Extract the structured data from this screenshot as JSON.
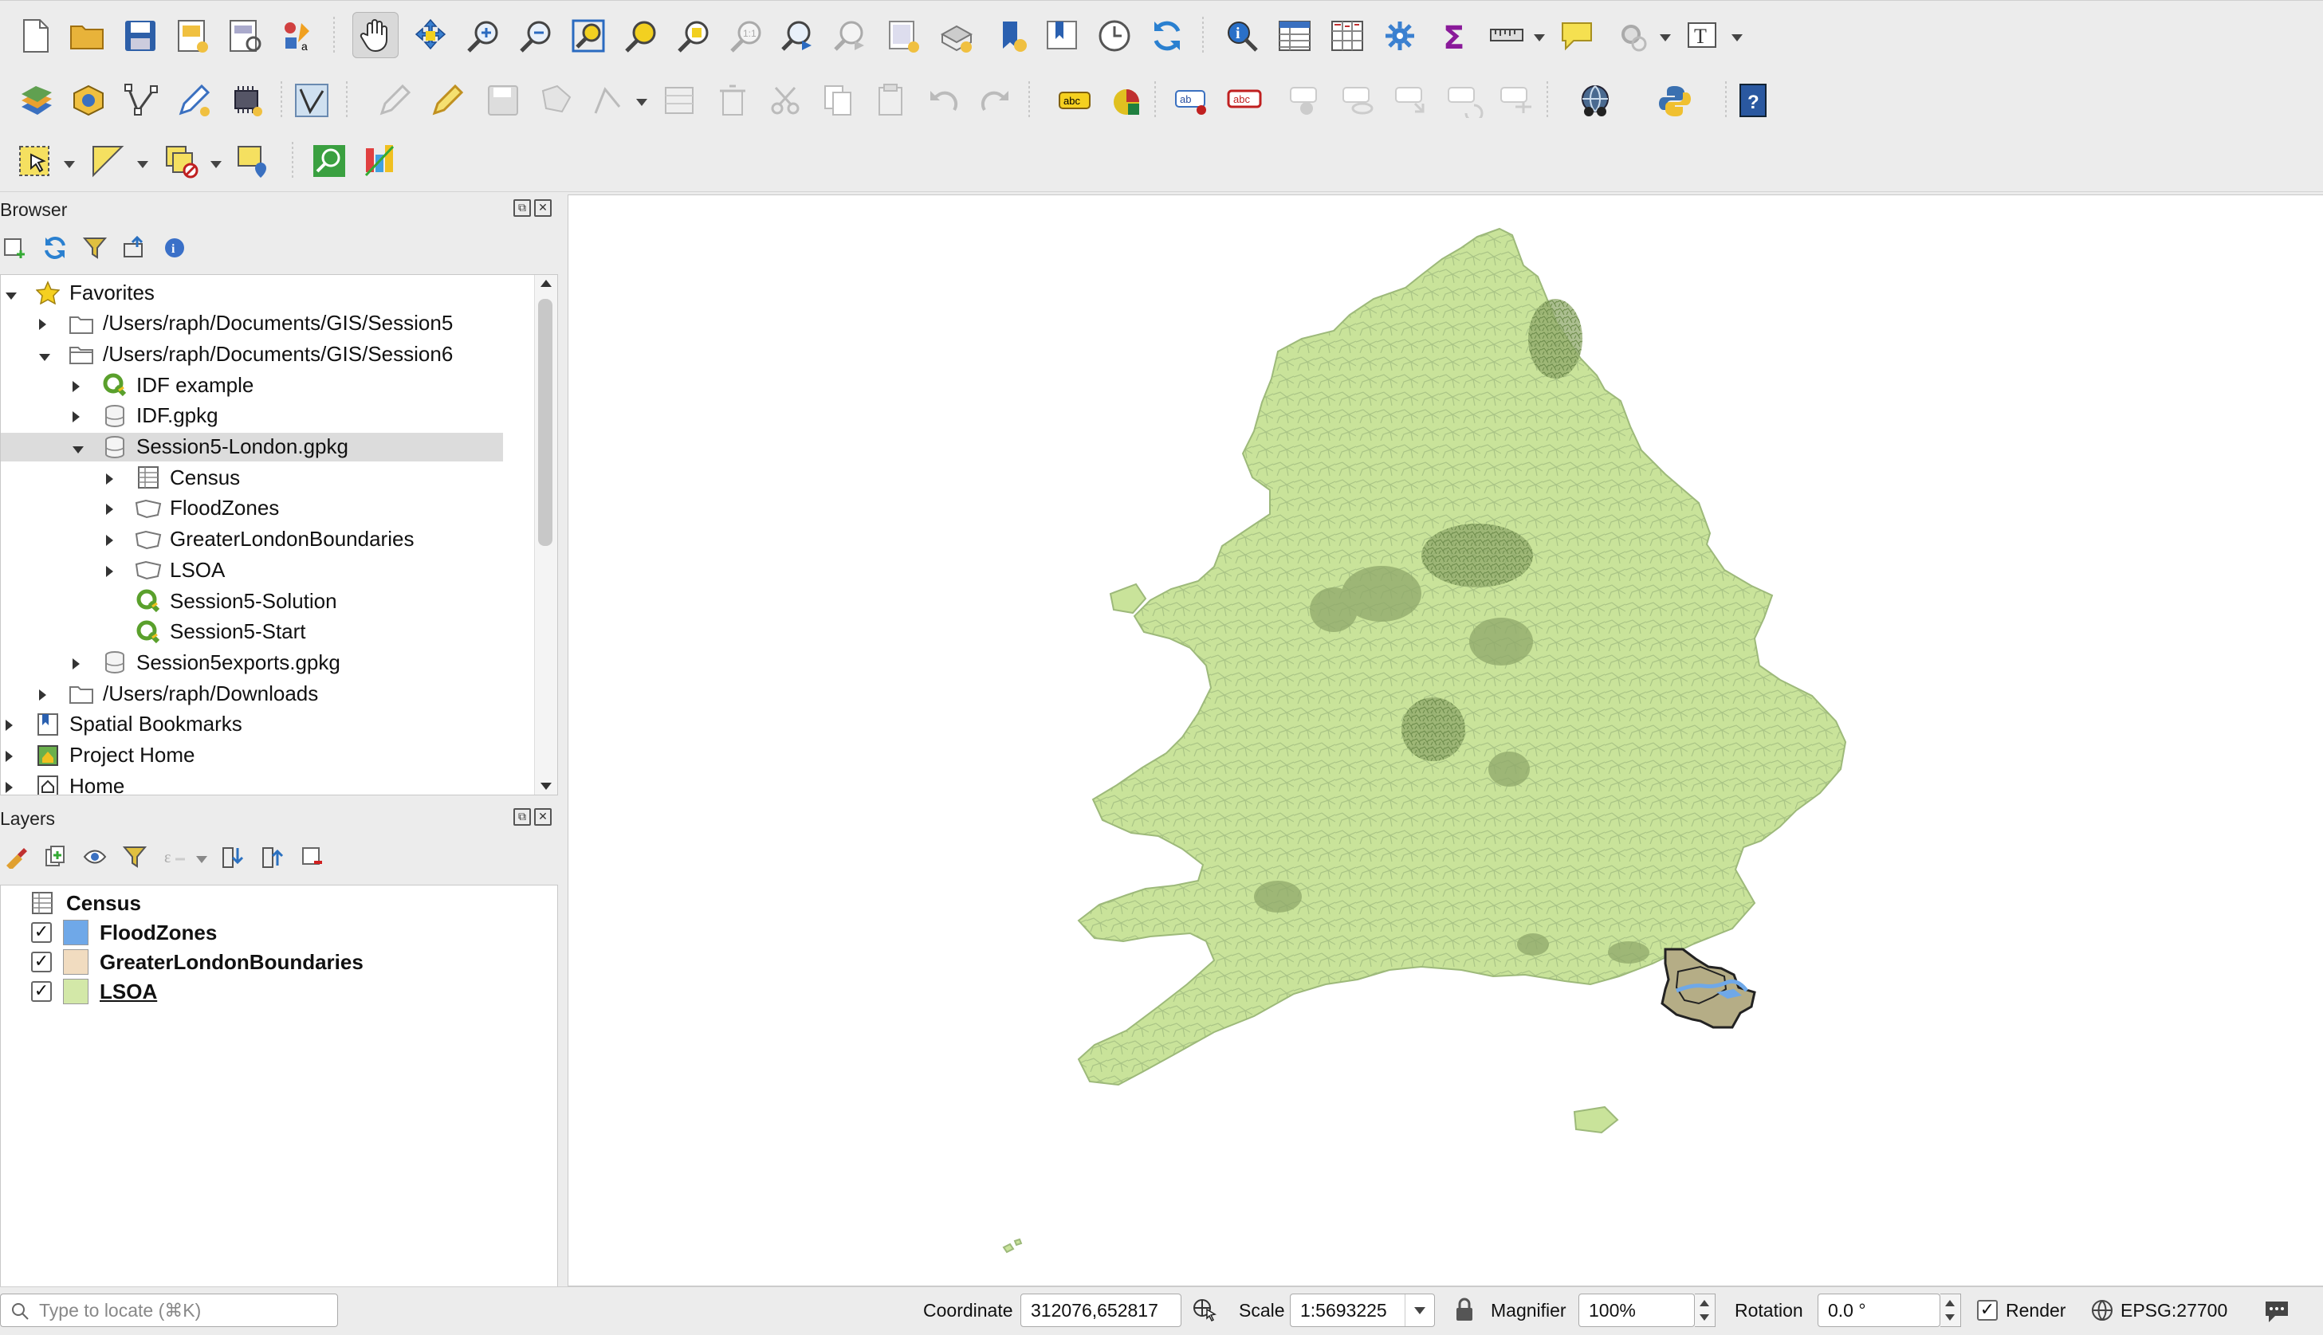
{
  "toolbar": {
    "row1_icons": [
      "new-project-icon",
      "open-project-icon",
      "save-project-icon",
      "new-print-layout-icon",
      "layout-manager-icon",
      "style-manager-icon",
      "pan-map-icon",
      "pan-to-selection-icon",
      "zoom-in-icon",
      "zoom-out-icon",
      "zoom-full-icon",
      "zoom-to-selection-icon",
      "zoom-to-layer-icon",
      "zoom-native-icon",
      "zoom-last-icon",
      "zoom-next-icon",
      "new-map-view-icon",
      "new-3d-view-icon",
      "new-bookmark-icon",
      "show-bookmarks-icon",
      "temporal-controller-icon",
      "refresh-icon",
      "identify-icon",
      "attribute-table-icon",
      "field-calculator-icon",
      "processing-toolbox-icon",
      "statistics-sum-icon",
      "measure-icon",
      "map-tips-icon",
      "annotation-gear-icon",
      "text-annotation-icon"
    ],
    "row2_icons": [
      "data-source-manager-icon",
      "new-geopackage-icon",
      "digitize-vertex-icon",
      "edit-pencil-icon",
      "gps-icon",
      "vertex-tool-icon",
      "current-edits-icon",
      "toggle-editing-icon",
      "save-edits-icon",
      "add-feature-icon",
      "vertex-edit-icon",
      "modify-attributes-icon",
      "delete-selected-icon",
      "cut-features-icon",
      "copy-features-icon",
      "paste-features-icon",
      "undo-icon",
      "redo-icon",
      "label-toolbar-icon",
      "diagram-icon",
      "pin-label-icon",
      "highlight-label-icon",
      "move-label-icon",
      "rotate-label-icon",
      "change-label-icon",
      "show-label-icon",
      "plugin-globe-icon",
      "python-console-icon",
      "help-icon"
    ],
    "row3_icons": [
      "select-features-icon",
      "select-by-value-icon",
      "deselect-features-icon",
      "select-location-icon",
      "locator-search-icon",
      "qgis-web-icon"
    ]
  },
  "browser": {
    "title": "Browser",
    "tree": [
      {
        "label": "Favorites",
        "level": 0,
        "icon": "star-icon",
        "expanded": true
      },
      {
        "label": "/Users/raph/Documents/GIS/Session5",
        "level": 1,
        "icon": "folder-icon",
        "expanded": false
      },
      {
        "label": "/Users/raph/Documents/GIS/Session6",
        "level": 1,
        "icon": "folder-open-icon",
        "expanded": true
      },
      {
        "label": "IDF example",
        "level": 2,
        "icon": "qgis-project-icon",
        "expanded": false
      },
      {
        "label": "IDF.gpkg",
        "level": 2,
        "icon": "geopackage-icon",
        "expanded": false
      },
      {
        "label": "Session5-London.gpkg",
        "level": 2,
        "icon": "geopackage-icon",
        "expanded": true,
        "selected": true
      },
      {
        "label": "Census",
        "level": 3,
        "icon": "table-icon",
        "expanded": false
      },
      {
        "label": "FloodZones",
        "level": 3,
        "icon": "polygon-layer-icon",
        "expanded": false
      },
      {
        "label": "GreaterLondonBoundaries",
        "level": 3,
        "icon": "polygon-layer-icon",
        "expanded": false
      },
      {
        "label": "LSOA",
        "level": 3,
        "icon": "polygon-layer-icon",
        "expanded": false
      },
      {
        "label": "Session5-Solution",
        "level": 3,
        "icon": "qgis-project-icon",
        "noexp": true
      },
      {
        "label": "Session5-Start",
        "level": 3,
        "icon": "qgis-project-icon",
        "noexp": true
      },
      {
        "label": "Session5exports.gpkg",
        "level": 2,
        "icon": "geopackage-icon",
        "expanded": false
      },
      {
        "label": "/Users/raph/Downloads",
        "level": 1,
        "icon": "folder-icon",
        "expanded": false
      },
      {
        "label": "Spatial Bookmarks",
        "level": 0,
        "icon": "bookmark-icon",
        "expanded": false
      },
      {
        "label": "Project Home",
        "level": 0,
        "icon": "project-home-icon",
        "expanded": false
      },
      {
        "label": "Home",
        "level": 0,
        "icon": "home-icon",
        "expanded": false
      },
      {
        "label": "/",
        "level": 0,
        "icon": "folder-icon",
        "expanded": true
      }
    ]
  },
  "layers": {
    "title": "Layers",
    "items": [
      {
        "label": "Census",
        "checkbox": false,
        "icon": "table-icon",
        "color": ""
      },
      {
        "label": "FloodZones",
        "checkbox": true,
        "checked": true,
        "color": "#6fa8e8"
      },
      {
        "label": "GreaterLondonBoundaries",
        "checkbox": true,
        "checked": true,
        "color": "#f1dcc0"
      },
      {
        "label": "LSOA",
        "checkbox": true,
        "checked": true,
        "color": "#d3e8a8",
        "underlined": true
      }
    ]
  },
  "map": {
    "background": "#ffffff",
    "lsoa_fill": "#c9e39a",
    "lsoa_stroke": "#9db97a",
    "dense_fill": "#8fa86a",
    "london_fill": "#b5ad86",
    "london_stroke": "#222222",
    "flood_fill": "#6fa8e8"
  },
  "status": {
    "locate_placeholder": "Type to locate (⌘K)",
    "coordinate_label": "Coordinate",
    "coordinate_value": "312076,652817",
    "scale_label": "Scale",
    "scale_value": "1:5693225",
    "magnifier_label": "Magnifier",
    "magnifier_value": "100%",
    "rotation_label": "Rotation",
    "rotation_value": "0.0 °",
    "render_label": "Render",
    "render_checked": "✓",
    "crs_label": "EPSG:27700"
  }
}
